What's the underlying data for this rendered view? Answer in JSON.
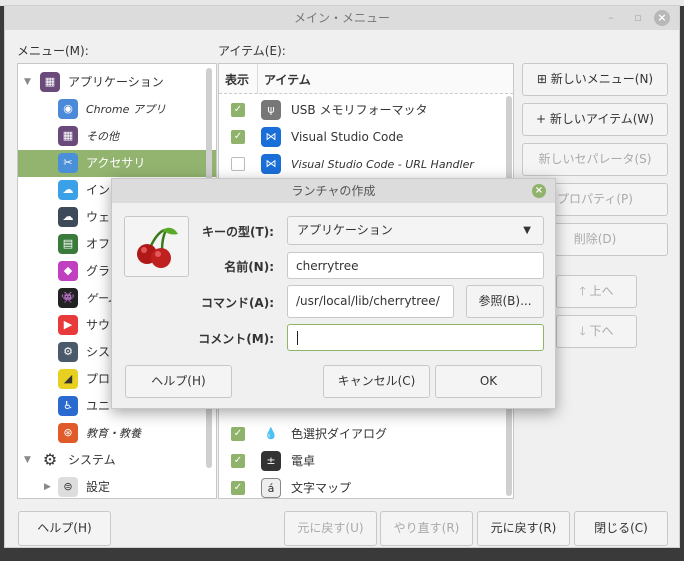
{
  "window": {
    "title": "メイン・メニュー",
    "minimize": "–",
    "maximize": "▫",
    "close": "×"
  },
  "menu_label": "メニュー(M):",
  "items_label": "アイテム(E):",
  "tree": [
    {
      "label": "アプリケーション",
      "icon": "apps-grid-icon",
      "color": "#6a4a7a",
      "level": 0,
      "expanded": true
    },
    {
      "label": "Chrome アプリ",
      "icon": "chrome-icon",
      "color": "#4a8ad8",
      "level": 1,
      "italic": true
    },
    {
      "label": "その他",
      "icon": "apps-grid-icon",
      "color": "#6a4a7a",
      "level": 1,
      "italic": true
    },
    {
      "label": "アクセサリ",
      "icon": "scissors-icon",
      "color": "#4a90d9",
      "level": 1,
      "selected": true
    },
    {
      "label": "イン",
      "icon": "cloud-icon",
      "color": "#3aa0e8",
      "level": 1
    },
    {
      "label": "ウェ",
      "icon": "web-cloud-icon",
      "color": "#3c4a5a",
      "level": 1
    },
    {
      "label": "オフ",
      "icon": "office-icon",
      "color": "#3a7a3a",
      "level": 1
    },
    {
      "label": "グラ",
      "icon": "graphics-icon",
      "color": "#c040c0",
      "level": 1
    },
    {
      "label": "ゲーム",
      "icon": "game-invader-icon",
      "color": "#222222",
      "level": 1,
      "italic": true
    },
    {
      "label": "サウ",
      "icon": "play-icon",
      "color": "#e83a3a",
      "level": 1
    },
    {
      "label": "シス",
      "icon": "gear-icon",
      "color": "#4a5a6a",
      "level": 1
    },
    {
      "label": "プロ",
      "icon": "programming-icon",
      "color": "#e8d020",
      "level": 1
    },
    {
      "label": "ユニ",
      "icon": "accessibility-icon",
      "color": "#2a6ad0",
      "level": 1
    },
    {
      "label": "教育・教養",
      "icon": "education-icon",
      "color": "#e05a2a",
      "level": 1,
      "italic": true
    },
    {
      "label": "システム",
      "icon": "gear-icon",
      "color": "#333333",
      "level": 0,
      "expanded": true
    },
    {
      "label": "設定",
      "icon": "settings-toggle-icon",
      "color": "#dddddd",
      "level": 1,
      "collapsed": true
    }
  ],
  "items_header": {
    "show": "表示",
    "item": "アイテム"
  },
  "items_top": [
    {
      "label": "USB メモリフォーマッタ",
      "checked": true,
      "icon": "usb-icon",
      "color": "#777777"
    },
    {
      "label": "Visual Studio Code",
      "checked": true,
      "icon": "vscode-icon",
      "color": "#1a6ed8"
    },
    {
      "label": "Visual Studio Code - URL Handler",
      "checked": false,
      "icon": "vscode-icon",
      "color": "#1a6ed8",
      "italic": true
    }
  ],
  "items_bottom": [
    {
      "label": "色選択ダイアログ",
      "checked": true,
      "icon": "color-drop-icon",
      "color": "#222222"
    },
    {
      "label": "電卓",
      "checked": true,
      "icon": "calculator-icon",
      "color": "#333333"
    },
    {
      "label": "文字マップ",
      "checked": true,
      "icon": "charmap-icon",
      "color": "#eeeeee"
    }
  ],
  "side_buttons": {
    "new_menu": "新しいメニュー(N)",
    "new_item": "新しいアイテム(W)",
    "new_separator": "新しいセパレータ(S)",
    "properties": "プロパティ(P)",
    "delete": "削除(D)",
    "up": "上へ",
    "down": "下へ"
  },
  "bottom_buttons": {
    "help": "ヘルプ(H)",
    "undo": "元に戻す(U)",
    "redo": "やり直す(R)",
    "revert": "元に戻す(R)",
    "close": "閉じる(C)"
  },
  "dialog": {
    "title": "ランチャの作成",
    "type_label": "キーの型(T):",
    "type_value": "アプリケーション",
    "name_label": "名前(N):",
    "name_value": "cherrytree",
    "command_label": "コマンド(A):",
    "command_value": "/usr/local/lib/cherrytree/",
    "browse": "参照(B)...",
    "comment_label": "コメント(M):",
    "comment_value": "",
    "help": "ヘルプ(H)",
    "cancel": "キャンセル(C)",
    "ok": "OK"
  },
  "colors": {
    "accent": "#92b46f",
    "check": "#8fb36a"
  }
}
